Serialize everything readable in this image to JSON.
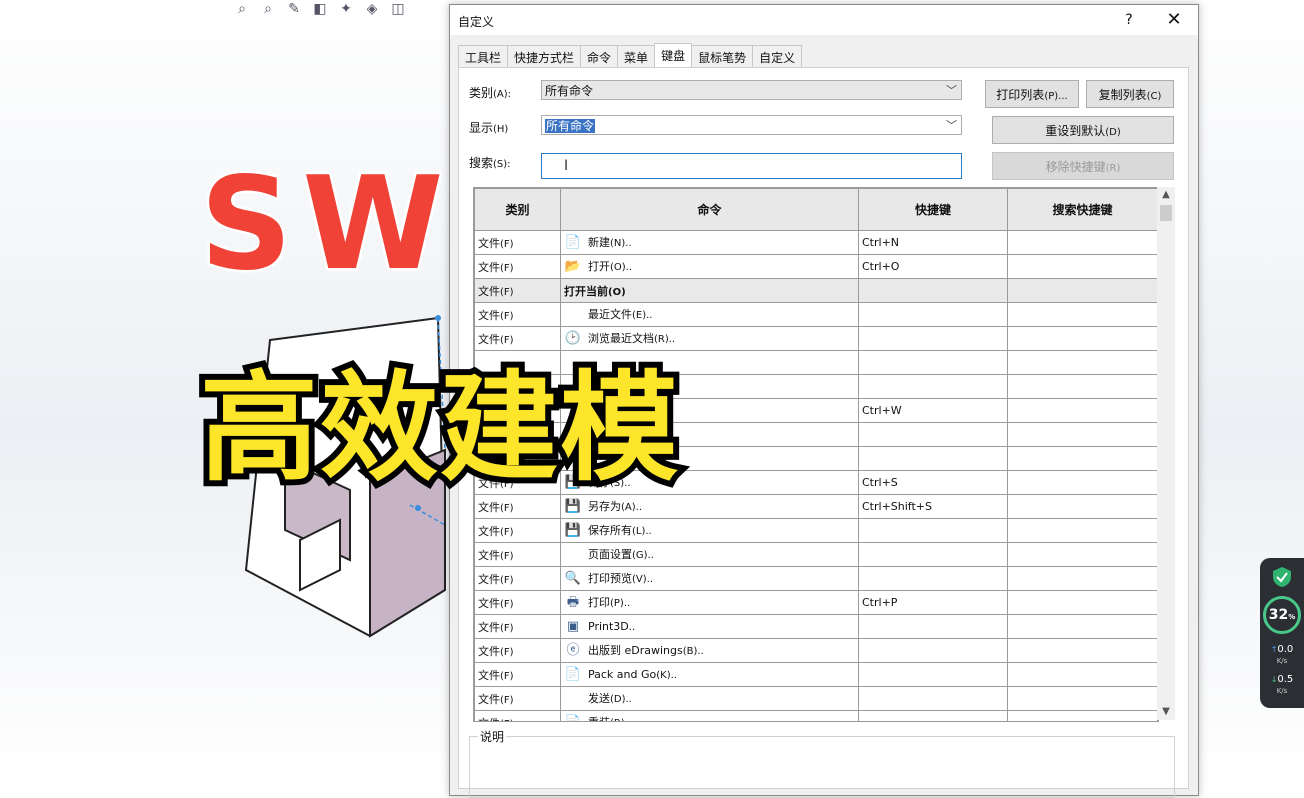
{
  "overlay": {
    "sw_text": "SW",
    "cn_text": "高效建模"
  },
  "dialog": {
    "title": "自定义",
    "help": "?",
    "close": "✕",
    "tabs": [
      "工具栏",
      "快捷方式栏",
      "命令",
      "菜单",
      "键盘",
      "鼠标笔势",
      "自定义"
    ],
    "active_tab": "键盘",
    "category_label": "类别",
    "category_key": "(A):",
    "category_value": "所有命令",
    "show_label": "显示",
    "show_key": "(H)",
    "show_value": "所有命令",
    "search_label": "搜索",
    "search_key": "(S):",
    "search_value": "",
    "btn_print": "打印列表",
    "btn_print_key": "(P)...",
    "btn_copy": "复制列表",
    "btn_copy_key": "(C)",
    "btn_reset": "重设到默认",
    "btn_reset_key": "(D)",
    "btn_remove": "移除快捷键",
    "btn_remove_key": "(R)",
    "columns": [
      "类别",
      "命令",
      "快捷键",
      "搜索快捷键"
    ],
    "rows": [
      {
        "cat": "文件",
        "cat_key": "(F)",
        "cmd": "新建",
        "cmd_key": "(N)..",
        "icon": "📄",
        "shortcut": "Ctrl+N",
        "search": ""
      },
      {
        "cat": "文件",
        "cat_key": "(F)",
        "cmd": "打开",
        "cmd_key": "(O)..",
        "icon": "📂",
        "shortcut": "Ctrl+O",
        "search": ""
      },
      {
        "cat": "文件",
        "cat_key": "(F)",
        "cmd": "打开当前",
        "cmd_key": "(O)",
        "icon": "",
        "shortcut": "",
        "search": "",
        "group": true
      },
      {
        "cat": "文件",
        "cat_key": "(F)",
        "cmd": "最近文件",
        "cmd_key": "(E)..",
        "icon": "",
        "shortcut": "",
        "search": ""
      },
      {
        "cat": "文件",
        "cat_key": "(F)",
        "cmd": "浏览最近文档",
        "cmd_key": "(R)..",
        "icon": "🕑",
        "shortcut": "",
        "search": ""
      },
      {
        "cat": "",
        "cat_key": "",
        "cmd": "",
        "cmd_key": "",
        "icon": "",
        "shortcut": "",
        "search": ""
      },
      {
        "cat": "",
        "cat_key": "",
        "cmd": "",
        "cmd_key": "",
        "icon": "",
        "shortcut": "",
        "search": ""
      },
      {
        "cat": "",
        "cat_key": "",
        "cmd": "",
        "cmd_key": "",
        "icon": "",
        "shortcut": "Ctrl+W",
        "search": ""
      },
      {
        "cat": "",
        "cat_key": "",
        "cmd": "",
        "cmd_key": "",
        "icon": "",
        "shortcut": "",
        "search": ""
      },
      {
        "cat": "",
        "cat_key": "",
        "cmd": "",
        "cmd_key": "",
        "icon": "",
        "shortcut": "",
        "search": ""
      },
      {
        "cat": "文件",
        "cat_key": "(F)",
        "cmd": "保存",
        "cmd_key": "(S)..",
        "icon": "💾",
        "shortcut": "Ctrl+S",
        "search": ""
      },
      {
        "cat": "文件",
        "cat_key": "(F)",
        "cmd": "另存为",
        "cmd_key": "(A)..",
        "icon": "💾",
        "shortcut": "Ctrl+Shift+S",
        "search": ""
      },
      {
        "cat": "文件",
        "cat_key": "(F)",
        "cmd": "保存所有",
        "cmd_key": "(L)..",
        "icon": "💾",
        "shortcut": "",
        "search": ""
      },
      {
        "cat": "文件",
        "cat_key": "(F)",
        "cmd": "页面设置",
        "cmd_key": "(G)..",
        "icon": "",
        "shortcut": "",
        "search": ""
      },
      {
        "cat": "文件",
        "cat_key": "(F)",
        "cmd": "打印预览",
        "cmd_key": "(V)..",
        "icon": "🔍",
        "shortcut": "",
        "search": ""
      },
      {
        "cat": "文件",
        "cat_key": "(F)",
        "cmd": "打印",
        "cmd_key": "(P)..",
        "icon": "🖶",
        "shortcut": "Ctrl+P",
        "search": ""
      },
      {
        "cat": "文件",
        "cat_key": "(F)",
        "cmd": "Print3D",
        "cmd_key": "..",
        "icon": "▣",
        "shortcut": "",
        "search": ""
      },
      {
        "cat": "文件",
        "cat_key": "(F)",
        "cmd": "出版到 eDrawings",
        "cmd_key": "(B)..",
        "icon": "ⓔ",
        "shortcut": "",
        "search": ""
      },
      {
        "cat": "文件",
        "cat_key": "(F)",
        "cmd": "Pack and Go",
        "cmd_key": "(K)..",
        "icon": "📄",
        "shortcut": "",
        "search": ""
      },
      {
        "cat": "文件",
        "cat_key": "(F)",
        "cmd": "发送",
        "cmd_key": "(D)..",
        "icon": "",
        "shortcut": "",
        "search": ""
      },
      {
        "cat": "文件",
        "cat_key": "(F)",
        "cmd": "重装",
        "cmd_key": "(R)",
        "icon": "📄",
        "shortcut": "",
        "search": ""
      }
    ],
    "desc_label": "说明"
  },
  "netwidget": {
    "pct": "32",
    "pct_unit": "%",
    "up": "0.0",
    "down": "0.5",
    "unit": "K/s"
  }
}
